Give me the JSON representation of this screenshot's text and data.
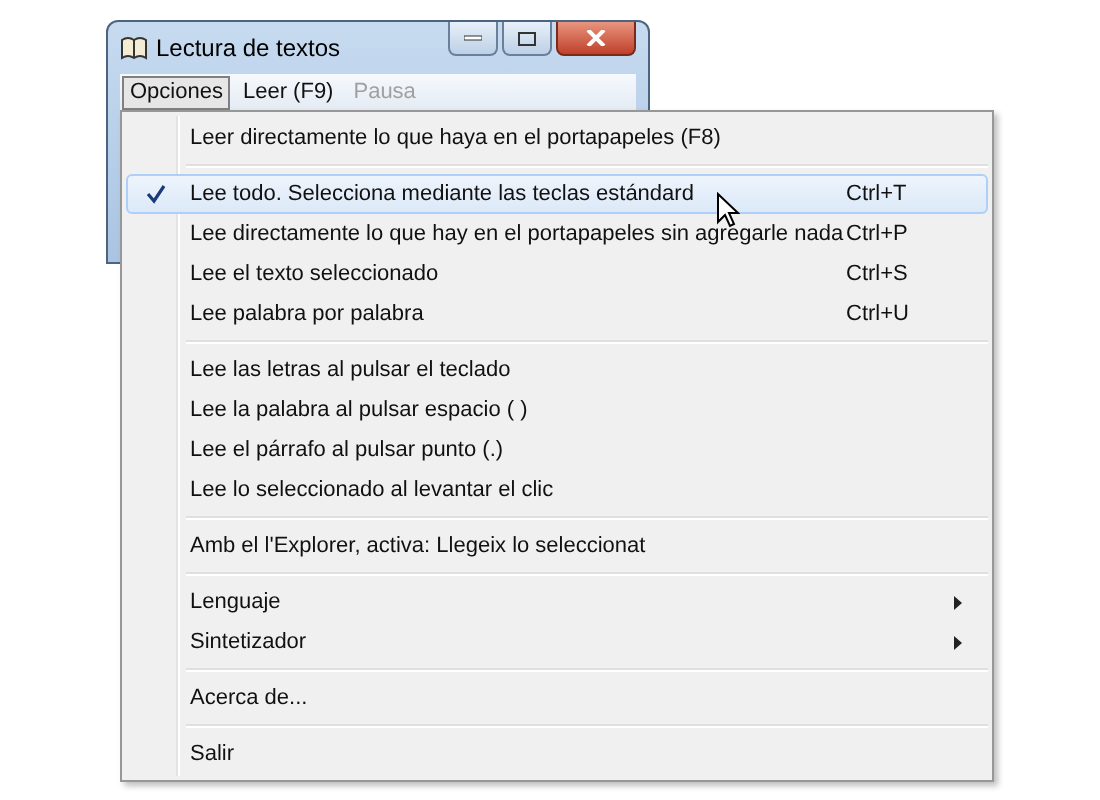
{
  "window": {
    "title": "Lectura de textos"
  },
  "menu_bar": [
    {
      "label": "Opciones",
      "selected": true,
      "disabled": false
    },
    {
      "label": "Leer (F9)",
      "selected": false,
      "disabled": false
    },
    {
      "label": "Pausa",
      "selected": false,
      "disabled": true
    }
  ],
  "menu": {
    "groups": [
      [
        {
          "label": "Leer directamente lo que haya en el portapapeles (F8)",
          "checked": false,
          "selected": false,
          "submenu": false
        }
      ],
      [
        {
          "label": "Lee todo. Selecciona mediante las teclas estándard",
          "shortcut": "Ctrl+T",
          "checked": true,
          "selected": true,
          "submenu": false
        },
        {
          "label": "Lee directamente lo que hay en el portapapeles sin agregarle nada",
          "shortcut": "Ctrl+P",
          "checked": false,
          "selected": false,
          "submenu": false
        },
        {
          "label": "Lee el texto seleccionado",
          "shortcut": "Ctrl+S",
          "checked": false,
          "selected": false,
          "submenu": false
        },
        {
          "label": "Lee palabra por palabra",
          "shortcut": "Ctrl+U",
          "checked": false,
          "selected": false,
          "submenu": false
        }
      ],
      [
        {
          "label": "Lee las letras al pulsar el teclado",
          "checked": false,
          "selected": false,
          "submenu": false
        },
        {
          "label": "Lee la palabra al pulsar espacio ( )",
          "checked": false,
          "selected": false,
          "submenu": false
        },
        {
          "label": "Lee el párrafo al pulsar punto (.)",
          "checked": false,
          "selected": false,
          "submenu": false
        },
        {
          "label": "Lee lo seleccionado al levantar el clic",
          "checked": false,
          "selected": false,
          "submenu": false
        }
      ],
      [
        {
          "label": "Amb el l'Explorer, activa: Llegeix lo seleccionat",
          "checked": false,
          "selected": false,
          "submenu": false
        }
      ],
      [
        {
          "label": "Lenguaje",
          "checked": false,
          "selected": false,
          "submenu": true
        },
        {
          "label": "Sintetizador",
          "checked": false,
          "selected": false,
          "submenu": true
        }
      ],
      [
        {
          "label": "Acerca de...",
          "checked": false,
          "selected": false,
          "submenu": false
        }
      ],
      [
        {
          "label": "Salir",
          "checked": false,
          "selected": false,
          "submenu": false
        }
      ]
    ]
  }
}
